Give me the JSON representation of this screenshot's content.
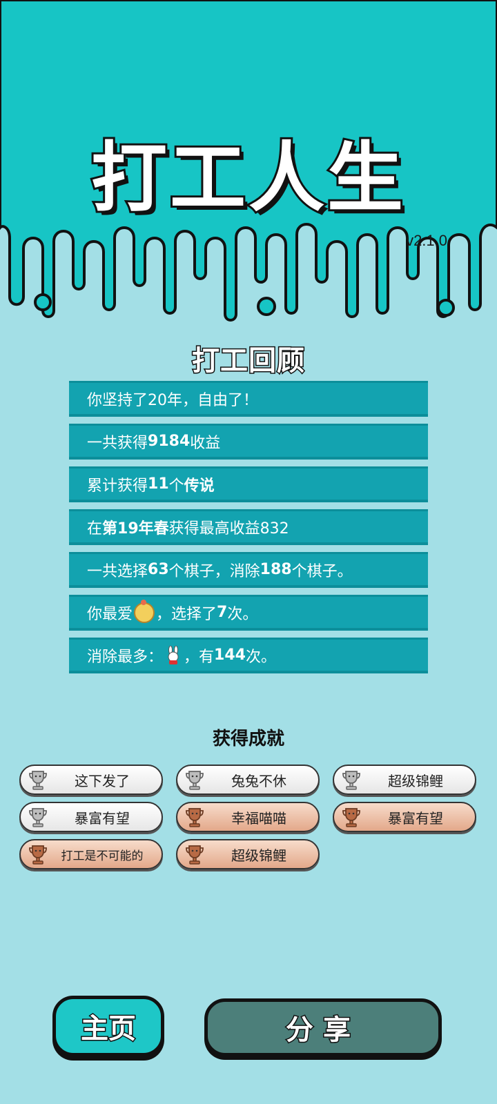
{
  "app": {
    "title": "打工人生",
    "version": "v2.1.0",
    "colors": {
      "top": "#17c5c5",
      "bottom": "#a3dfe6",
      "row": "#13a3b0",
      "share_button": "#4c7f7a"
    }
  },
  "review": {
    "title": "打工回顾",
    "rows": [
      {
        "parts": [
          {
            "text": "你坚持了20年，自由了！",
            "bold": false
          }
        ]
      },
      {
        "parts": [
          {
            "text": "一共获得",
            "bold": false
          },
          {
            "text": "9184",
            "bold": true
          },
          {
            "text": "收益",
            "bold": false
          }
        ]
      },
      {
        "parts": [
          {
            "text": "累计获得",
            "bold": false
          },
          {
            "text": "11",
            "bold": true
          },
          {
            "text": "个",
            "bold": false
          },
          {
            "text": "传说",
            "bold": true
          }
        ]
      },
      {
        "parts": [
          {
            "text": "在 ",
            "bold": false
          },
          {
            "text": "第19年春",
            "bold": true
          },
          {
            "text": " 获得最高收益832",
            "bold": false
          }
        ]
      },
      {
        "parts": [
          {
            "text": "一共选择",
            "bold": false
          },
          {
            "text": "63",
            "bold": true
          },
          {
            "text": "个棋子，消除",
            "bold": false
          },
          {
            "text": "188",
            "bold": true
          },
          {
            "text": "个棋子。",
            "bold": false
          }
        ]
      },
      {
        "parts": [
          {
            "text": "你最爱",
            "bold": false
          },
          {
            "icon": "chick-icon"
          },
          {
            "text": "，选择了",
            "bold": false
          },
          {
            "text": "7",
            "bold": true
          },
          {
            "text": "次。",
            "bold": false
          }
        ]
      },
      {
        "parts": [
          {
            "text": "消除最多：",
            "bold": false
          },
          {
            "icon": "rabbit-icon"
          },
          {
            "text": "，有",
            "bold": false
          },
          {
            "text": "144",
            "bold": true
          },
          {
            "text": "次。",
            "bold": false
          }
        ]
      }
    ]
  },
  "achievements": {
    "title": "获得成就",
    "items": [
      {
        "label": "这下发了",
        "tier": "silver",
        "icon": "trophy-icon"
      },
      {
        "label": "兔兔不休",
        "tier": "silver",
        "icon": "trophy-icon"
      },
      {
        "label": "超级锦鲤",
        "tier": "silver",
        "icon": "trophy-icon"
      },
      {
        "label": "暴富有望",
        "tier": "silver",
        "icon": "trophy-icon"
      },
      {
        "label": "幸福喵喵",
        "tier": "bronze",
        "icon": "trophy-icon"
      },
      {
        "label": "暴富有望",
        "tier": "bronze",
        "icon": "trophy-icon"
      },
      {
        "label": "打工是不可能的",
        "tier": "bronze",
        "icon": "trophy-icon"
      },
      {
        "label": "超级锦鲤",
        "tier": "bronze",
        "icon": "trophy-icon"
      }
    ]
  },
  "buttons": {
    "home": "主页",
    "share": "分享"
  }
}
